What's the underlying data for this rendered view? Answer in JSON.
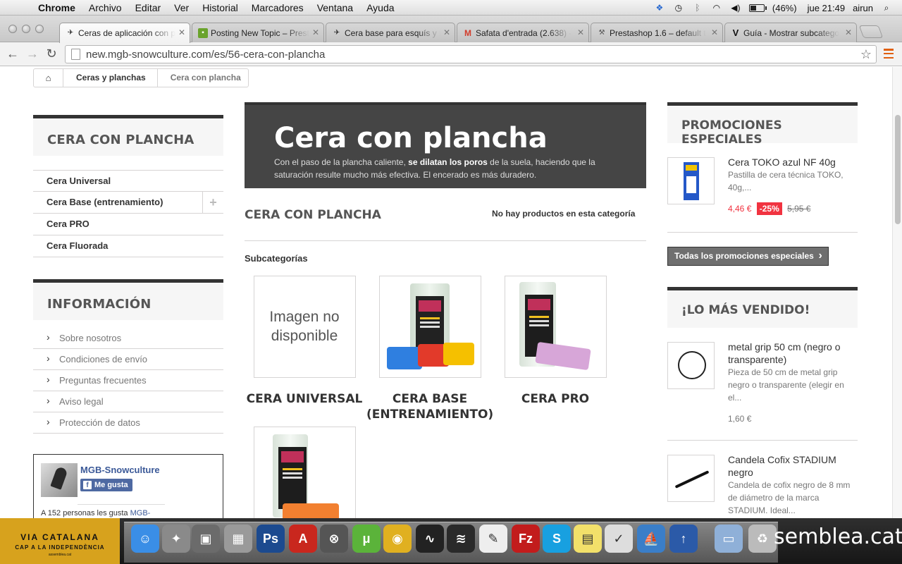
{
  "menubar": {
    "app": "Chrome",
    "items": [
      "Archivo",
      "Editar",
      "Ver",
      "Historial",
      "Marcadores",
      "Ventana",
      "Ayuda"
    ],
    "battery": "(46%)",
    "battery_level": 0.46,
    "clock": "jue 21:49",
    "user": "airun"
  },
  "tabs": [
    {
      "label": "Ceras de aplicación con p",
      "favicon": "skier-icon",
      "active": true
    },
    {
      "label": "Posting New Topic – Prest",
      "favicon": "prestashop-forum-icon"
    },
    {
      "label": "Cera base para esquís y t",
      "favicon": "skier-icon"
    },
    {
      "label": "Safata d'entrada (2.638) -",
      "favicon": "gmail-icon"
    },
    {
      "label": "Prestashop 1.6 – default t",
      "favicon": "wrench-icon"
    },
    {
      "label": "Guía - Mostrar subcatego",
      "favicon": "v-icon"
    }
  ],
  "address_bar": {
    "url": "new.mgb-snowculture.com/es/56-cera-con-plancha"
  },
  "breadcrumb": {
    "items": [
      "Ceras y planchas",
      "Cera con plancha"
    ]
  },
  "left_column": {
    "category_block_title": "CERA CON PLANCHA",
    "categories": [
      {
        "label": "Cera Universal",
        "expandable": false
      },
      {
        "label": "Cera Base (entrenamiento)",
        "expandable": true,
        "toggle": "+"
      },
      {
        "label": "Cera PRO",
        "expandable": false
      },
      {
        "label": "Cera Fluorada",
        "expandable": false
      }
    ],
    "info_block_title": "INFORMACIÓN",
    "info_links": [
      "Sobre nosotros",
      "Condiciones de envío",
      "Preguntas frecuentes",
      "Aviso legal",
      "Protección de datos"
    ],
    "facebook": {
      "page_name": "MGB-Snowculture",
      "like_label": "Me gusta",
      "count_text": "A 152 personas les gusta",
      "count_link": "MGB-"
    }
  },
  "main": {
    "banner_title": "Cera con plancha",
    "banner_desc_1": "Con el paso de la plancha caliente, ",
    "banner_desc_bold": "se dilatan los poros",
    "banner_desc_2": " de la suela, haciendo que la saturación resulte mucho más efectiva. El encerado es más duradero.",
    "category_heading": "CERA CON PLANCHA",
    "product_count": "No hay productos en esta categoría",
    "subcategories_heading": "Subcategorías",
    "subcategories": [
      {
        "name": "CERA UNIVERSAL",
        "no_image_text": "Imagen no disponible"
      },
      {
        "name": "CERA BASE (ENTRENAMIENTO)"
      },
      {
        "name": "CERA PRO"
      },
      {
        "name": ""
      }
    ]
  },
  "right_column": {
    "promo_title": "PROMOCIONES ESPECIALES",
    "promo_product": {
      "name": "Cera TOKO azul NF 40g",
      "desc": "Pastilla de cera técnica TOKO, 40g,...",
      "price": "4,46 €",
      "discount": "-25%",
      "old_price": "5,95 €"
    },
    "all_promos_label": "Todas los promociones especiales",
    "bestsellers_title": "¡LO MÁS VENDIDO!",
    "bestsellers": [
      {
        "name": "metal grip 50 cm (negro o transparente)",
        "desc": "Pieza de 50 cm de metal grip negro o transparente (elegir en el...",
        "price": "1,60 €"
      },
      {
        "name": "Candela Cofix STADIUM negro",
        "desc": "Candela de cofix negro de 8 mm de diámetro de la marca STADIUM. Ideal..."
      }
    ]
  },
  "dock": {
    "via_title": "VIA CATALANA",
    "via_sub": "CAP A LA INDEPENDÈNCIA",
    "via_url": "assemblea.cat",
    "overlay_text": "semblea.cat",
    "icons": [
      "finder-icon",
      "launchpad-icon",
      "photo-icon",
      "calculator-icon",
      "photoshop-icon",
      "acrobat-icon",
      "app-store-icon",
      "utorrent-icon",
      "chrome-icon",
      "activity-monitor-icon",
      "spotify-icon",
      "textedit-icon",
      "filezilla-icon",
      "skype-icon",
      "stickies-icon",
      "omnifocus-icon",
      "ftp-client-icon",
      "uploader-icon",
      "folder-icon",
      "trash-icon"
    ]
  }
}
